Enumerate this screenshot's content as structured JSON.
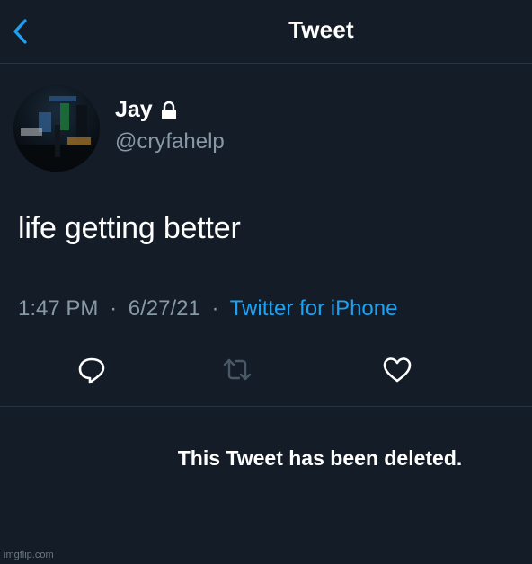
{
  "header": {
    "title": "Tweet",
    "back_icon": "chevron-left-icon"
  },
  "author": {
    "display_name": "Jay",
    "handle": "@cryfahelp",
    "protected_icon": "lock-icon"
  },
  "tweet": {
    "text": "life getting better",
    "time": "1:47 PM",
    "date": "6/27/21",
    "separator": "·",
    "source": "Twitter for iPhone"
  },
  "actions": {
    "reply_icon": "reply-icon",
    "retweet_icon": "retweet-icon",
    "like_icon": "heart-icon"
  },
  "deleted_notice": "This Tweet has been deleted.",
  "watermark": "imgflip.com",
  "colors": {
    "background": "#141d27",
    "text": "#ffffff",
    "secondary_text": "#8899a6",
    "link": "#1da1f2",
    "divider": "#263340"
  }
}
